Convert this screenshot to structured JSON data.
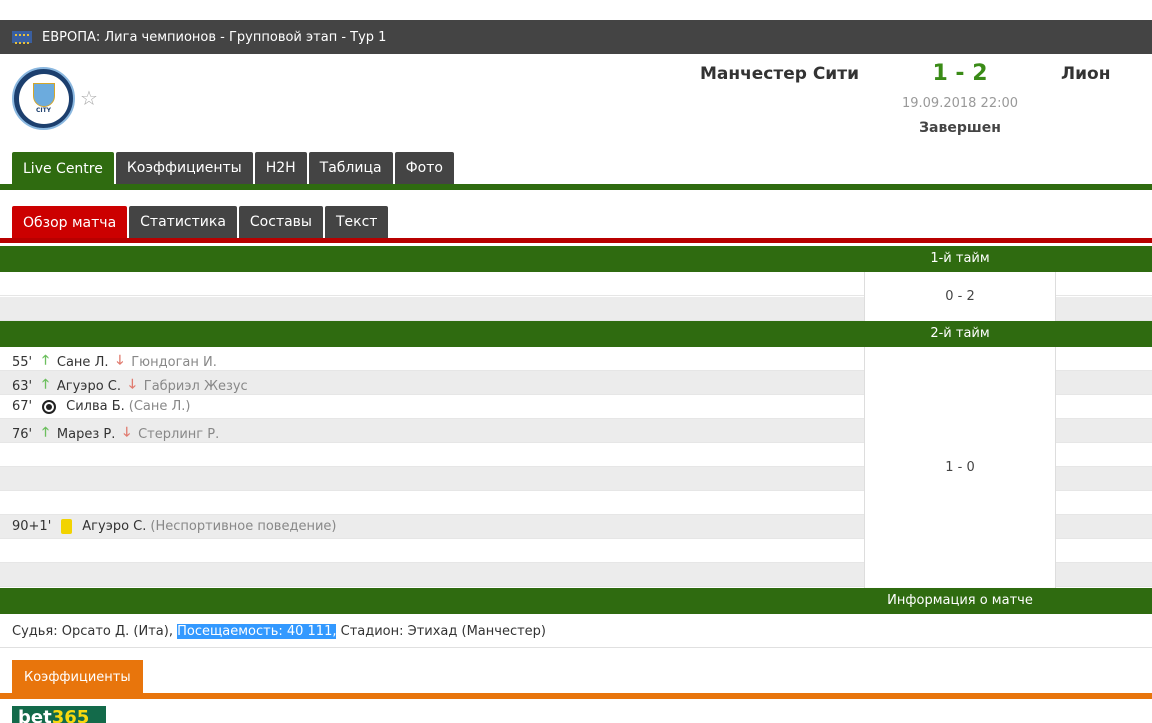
{
  "header": {
    "competition": "ЕВРОПА: Лига чемпионов - Групповой этап - Тур 1"
  },
  "match": {
    "home_team": "Манчестер Сити",
    "away_team": "Лион",
    "score": "1 - 2",
    "datetime": "19.09.2018 22:00",
    "status": "Завершен",
    "crest_text": "CITY"
  },
  "tabs": {
    "main": [
      "Live Centre",
      "Коэффициенты",
      "H2H",
      "Таблица",
      "Фото"
    ],
    "sub": [
      "Обзор матча",
      "Статистика",
      "Составы",
      "Текст"
    ]
  },
  "first_half": {
    "title": "1-й тайм",
    "score": "0 - 2"
  },
  "second_half": {
    "title": "2-й тайм",
    "score": "1 - 0",
    "events": [
      {
        "minute": "55'",
        "type": "substitution",
        "in": "Сане Л.",
        "out": "Гюндоган И."
      },
      {
        "minute": "63'",
        "type": "substitution",
        "in": "Агуэро С.",
        "out": "Габриэл Жезус"
      },
      {
        "minute": "67'",
        "type": "goal",
        "player": "Силва Б.",
        "assist": "(Сане Л.)"
      },
      {
        "minute": "76'",
        "type": "substitution",
        "in": "Марез Р.",
        "out": "Стерлинг Р."
      },
      {
        "minute": "90+1'",
        "type": "yellow-card",
        "player": "Агуэро С.",
        "reason": "(Неспортивное поведение)"
      }
    ]
  },
  "match_info": {
    "title": "Информация о матче",
    "referee": "Судья: Орсато Д. (Ита),",
    "attendance": "Посещаемость: 40 111,",
    "stadium": "Стадион: Этихад (Манчестер)"
  },
  "odds_tab": "Коэффициенты",
  "bookmaker": {
    "part1": "bet",
    "part2": "365"
  },
  "colors": {
    "green": "#2f6b10",
    "red": "#c00000",
    "orange": "#e8750c",
    "dark": "#444444",
    "score_green": "#3a8b17"
  }
}
